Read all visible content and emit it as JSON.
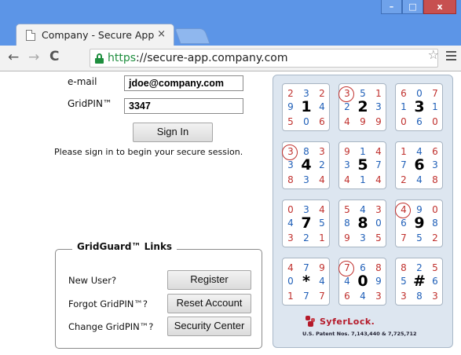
{
  "browser": {
    "tab_title": "Company - Secure App",
    "tab_close": "×",
    "url_https": "https",
    "url_rest": "://secure-app.company.com",
    "controls": {
      "minimize": "–",
      "maximize": "□",
      "close": "x"
    }
  },
  "login": {
    "email_label": "e-mail",
    "email_value": "jdoe@company.com",
    "gridpin_label": "GridPIN™",
    "gridpin_value": "3347",
    "sign_in": "Sign In",
    "hint": "Please sign in to begin your secure session."
  },
  "links": {
    "title": "GridGuard™ Links",
    "new_user_label": "New User?",
    "register": "Register",
    "forgot_label": "Forgot GridPIN™?",
    "reset": "Reset Account",
    "change_label": "Change GridPIN™?",
    "security_center": "Security Center"
  },
  "grid": {
    "colors": {
      "red": "#c0312e",
      "blue": "#1f5fb8",
      "big": "#000000",
      "circle": "#c0312e"
    },
    "cells": [
      {
        "center": "1",
        "nums": [
          [
            "2",
            "red"
          ],
          [
            "3",
            "blue"
          ],
          [
            "2",
            "red"
          ],
          [
            "9",
            "blue"
          ],
          [
            "4",
            "blue"
          ],
          [
            "5",
            "red"
          ],
          [
            "0",
            "blue"
          ],
          [
            "6",
            "red"
          ]
        ]
      },
      {
        "center": "2",
        "nums": [
          [
            "3",
            "red"
          ],
          [
            "5",
            "blue"
          ],
          [
            "1",
            "red"
          ],
          [
            "2",
            "blue"
          ],
          [
            "3",
            "blue"
          ],
          [
            "4",
            "red"
          ],
          [
            "9",
            "red"
          ],
          [
            "9",
            "red"
          ]
        ],
        "circled": 0
      },
      {
        "center": "3",
        "nums": [
          [
            "6",
            "red"
          ],
          [
            "0",
            "blue"
          ],
          [
            "7",
            "red"
          ],
          [
            "1",
            "blue"
          ],
          [
            "1",
            "blue"
          ],
          [
            "0",
            "red"
          ],
          [
            "6",
            "blue"
          ],
          [
            "0",
            "red"
          ]
        ]
      },
      {
        "center": "4",
        "nums": [
          [
            "3",
            "red"
          ],
          [
            "8",
            "blue"
          ],
          [
            "3",
            "red"
          ],
          [
            "3",
            "blue"
          ],
          [
            "2",
            "blue"
          ],
          [
            "8",
            "red"
          ],
          [
            "3",
            "blue"
          ],
          [
            "4",
            "red"
          ]
        ],
        "circled": 0
      },
      {
        "center": "5",
        "nums": [
          [
            "9",
            "red"
          ],
          [
            "1",
            "blue"
          ],
          [
            "4",
            "red"
          ],
          [
            "3",
            "blue"
          ],
          [
            "7",
            "blue"
          ],
          [
            "4",
            "red"
          ],
          [
            "1",
            "blue"
          ],
          [
            "4",
            "red"
          ]
        ]
      },
      {
        "center": "6",
        "nums": [
          [
            "1",
            "red"
          ],
          [
            "4",
            "blue"
          ],
          [
            "6",
            "red"
          ],
          [
            "7",
            "blue"
          ],
          [
            "3",
            "blue"
          ],
          [
            "2",
            "red"
          ],
          [
            "4",
            "blue"
          ],
          [
            "8",
            "red"
          ]
        ]
      },
      {
        "center": "7",
        "nums": [
          [
            "0",
            "red"
          ],
          [
            "3",
            "blue"
          ],
          [
            "4",
            "red"
          ],
          [
            "4",
            "blue"
          ],
          [
            "5",
            "blue"
          ],
          [
            "3",
            "red"
          ],
          [
            "2",
            "blue"
          ],
          [
            "1",
            "red"
          ]
        ]
      },
      {
        "center": "8",
        "nums": [
          [
            "5",
            "red"
          ],
          [
            "4",
            "blue"
          ],
          [
            "3",
            "red"
          ],
          [
            "8",
            "blue"
          ],
          [
            "0",
            "blue"
          ],
          [
            "9",
            "red"
          ],
          [
            "3",
            "blue"
          ],
          [
            "5",
            "red"
          ]
        ]
      },
      {
        "center": "9",
        "nums": [
          [
            "4",
            "red"
          ],
          [
            "9",
            "blue"
          ],
          [
            "0",
            "red"
          ],
          [
            "6",
            "blue"
          ],
          [
            "8",
            "blue"
          ],
          [
            "7",
            "red"
          ],
          [
            "5",
            "blue"
          ],
          [
            "2",
            "red"
          ]
        ],
        "circled": 0
      },
      {
        "center": "*",
        "nums": [
          [
            "4",
            "red"
          ],
          [
            "7",
            "blue"
          ],
          [
            "9",
            "red"
          ],
          [
            "0",
            "blue"
          ],
          [
            "4",
            "blue"
          ],
          [
            "1",
            "red"
          ],
          [
            "7",
            "blue"
          ],
          [
            "7",
            "red"
          ]
        ]
      },
      {
        "center": "0",
        "nums": [
          [
            "7",
            "red"
          ],
          [
            "6",
            "blue"
          ],
          [
            "8",
            "red"
          ],
          [
            "4",
            "blue"
          ],
          [
            "9",
            "blue"
          ],
          [
            "6",
            "red"
          ],
          [
            "4",
            "blue"
          ],
          [
            "3",
            "red"
          ]
        ],
        "circled": 0
      },
      {
        "center": "#",
        "nums": [
          [
            "8",
            "red"
          ],
          [
            "2",
            "blue"
          ],
          [
            "5",
            "red"
          ],
          [
            "5",
            "blue"
          ],
          [
            "6",
            "blue"
          ],
          [
            "3",
            "red"
          ],
          [
            "8",
            "blue"
          ],
          [
            "3",
            "red"
          ]
        ]
      }
    ]
  },
  "logo": {
    "word": "SyferLock.",
    "patent": "U.S. Patent Nos. 7,143,440 & 7,725,712"
  }
}
